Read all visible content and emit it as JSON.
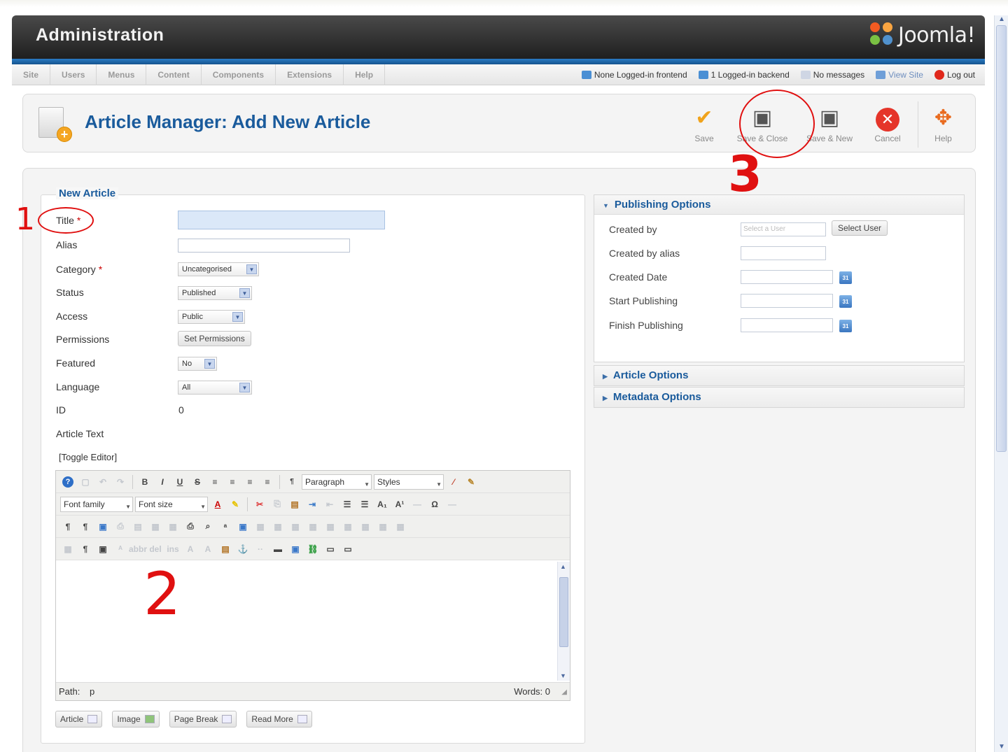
{
  "header": {
    "title": "Administration",
    "logo_text": "Joomla!"
  },
  "menu": {
    "items": [
      "Site",
      "Users",
      "Menus",
      "Content",
      "Components",
      "Extensions",
      "Help"
    ],
    "status": {
      "frontend": "None Logged-in frontend",
      "backend": "1 Logged-in backend",
      "messages": "No messages",
      "view_site": "View Site",
      "logout": "Log out"
    }
  },
  "toolbar": {
    "page_title": "Article Manager: Add New Article",
    "save": "Save",
    "save_close": "Save & Close",
    "save_new": "Save & New",
    "cancel": "Cancel",
    "help": "Help"
  },
  "form": {
    "legend": "New Article",
    "title_label": "Title",
    "required_mark": "*",
    "alias_label": "Alias",
    "category_label": "Category",
    "category_value": "Uncategorised",
    "status_label": "Status",
    "status_value": "Published",
    "access_label": "Access",
    "access_value": "Public",
    "permissions_label": "Permissions",
    "permissions_button": "Set Permissions",
    "featured_label": "Featured",
    "featured_value": "No",
    "language_label": "Language",
    "language_value": "All",
    "id_label": "ID",
    "id_value": "0",
    "article_text_label": "Article Text",
    "toggle_editor": "[Toggle Editor]"
  },
  "editor": {
    "format_value": "Paragraph",
    "styles_value": "Styles",
    "font_family": "Font family",
    "font_size": "Font size",
    "path_label": "Path:",
    "path_value": "p",
    "words_label": "Words: 0"
  },
  "editor_buttons": [
    "Article",
    "Image",
    "Page Break",
    "Read More"
  ],
  "publishing": {
    "header": "Publishing Options",
    "created_by": "Created by",
    "created_by_placeholder": "Select a User",
    "select_user": "Select User",
    "created_by_alias": "Created by alias",
    "created_date": "Created Date",
    "start_publishing": "Start Publishing",
    "finish_publishing": "Finish Publishing"
  },
  "article_options": "Article Options",
  "metadata_options": "Metadata Options",
  "annotations": {
    "one": "1",
    "two": "2",
    "three": "3"
  },
  "colors": {
    "accent_blue": "#1a5b9c",
    "annotation_red": "#e01010",
    "header_dark": "#2a2a2a"
  }
}
